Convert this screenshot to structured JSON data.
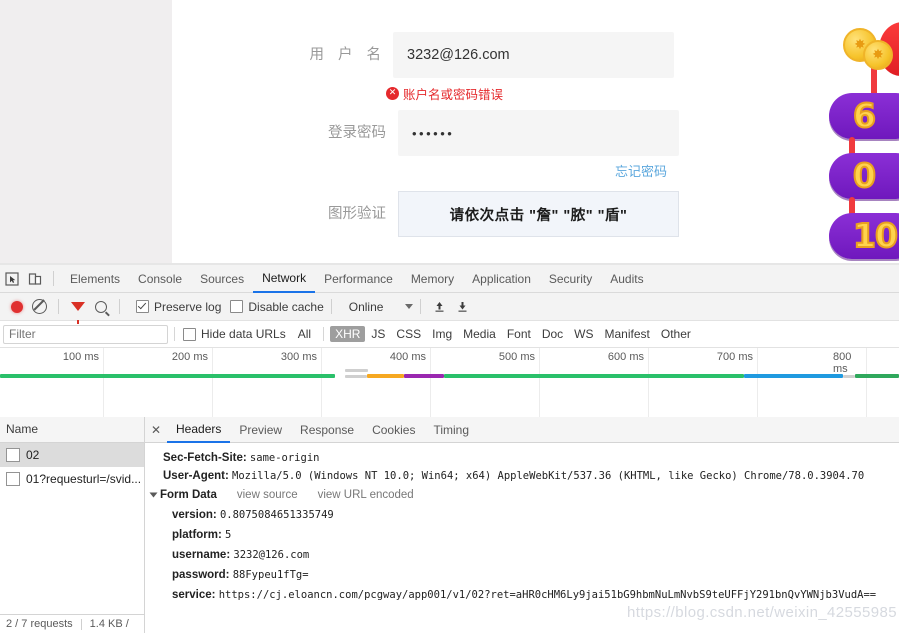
{
  "login": {
    "username": {
      "label": "用 户 名",
      "value": "3232@126.com",
      "error": "账户名或密码错误",
      "error_icon": "error-circle-icon"
    },
    "password": {
      "label": "登录密码",
      "value": "••••••",
      "forgot_label": "忘记密码"
    },
    "captcha": {
      "label": "图形验证",
      "prompt": "请依次点击 \"詹\" \"脓\" \"盾\""
    },
    "decoration": {
      "pill_numbers": [
        "6",
        "0",
        "10."
      ],
      "coin_icon": "coin-icon",
      "red_blob_icon": "red-blob-icon"
    }
  },
  "devtools": {
    "icons": {
      "inspect": "inspect-element-icon",
      "device": "device-toolbar-icon"
    },
    "panels": [
      {
        "label": "Elements",
        "active": false
      },
      {
        "label": "Console",
        "active": false
      },
      {
        "label": "Sources",
        "active": false
      },
      {
        "label": "Network",
        "active": true
      },
      {
        "label": "Performance",
        "active": false
      },
      {
        "label": "Memory",
        "active": false
      },
      {
        "label": "Application",
        "active": false
      },
      {
        "label": "Security",
        "active": false
      },
      {
        "label": "Audits",
        "active": false
      }
    ],
    "toolbar": {
      "record_icon": "record-icon",
      "clear_icon": "clear-icon",
      "filter_icon": "filter-icon",
      "search_icon": "search-icon",
      "preserve_log": {
        "label": "Preserve log",
        "checked": true
      },
      "disable_cache": {
        "label": "Disable cache",
        "checked": false
      },
      "throttling": {
        "value": "Online"
      },
      "import_icon": "import-har-icon",
      "export_icon": "export-har-icon"
    },
    "filterbar": {
      "filter_placeholder": "Filter",
      "filter_value": "",
      "hide_data_urls": {
        "label": "Hide data URLs",
        "checked": false
      },
      "types": [
        {
          "label": "All",
          "active": false
        },
        {
          "label": "XHR",
          "active": true
        },
        {
          "label": "JS",
          "active": false
        },
        {
          "label": "CSS",
          "active": false
        },
        {
          "label": "Img",
          "active": false
        },
        {
          "label": "Media",
          "active": false
        },
        {
          "label": "Font",
          "active": false
        },
        {
          "label": "Doc",
          "active": false
        },
        {
          "label": "WS",
          "active": false
        },
        {
          "label": "Manifest",
          "active": false
        },
        {
          "label": "Other",
          "active": false
        }
      ]
    },
    "overview": {
      "ticks": [
        "100 ms",
        "200 ms",
        "300 ms",
        "400 ms",
        "500 ms",
        "600 ms",
        "700 ms",
        "800 ms"
      ]
    },
    "requests": {
      "column_header": "Name",
      "rows": [
        {
          "name": "02",
          "selected": true
        },
        {
          "name": "01?requesturl=/svid...",
          "selected": false
        }
      ],
      "status": {
        "requests": "2 / 7 requests",
        "transferred": "1.4 KB /"
      }
    },
    "detail": {
      "close_icon": "close-icon",
      "tabs": [
        {
          "label": "Headers",
          "active": true
        },
        {
          "label": "Preview",
          "active": false
        },
        {
          "label": "Response",
          "active": false
        },
        {
          "label": "Cookies",
          "active": false
        },
        {
          "label": "Timing",
          "active": false
        }
      ],
      "headers": [
        {
          "name": "Sec-Fetch-Site:",
          "value": "same-origin"
        },
        {
          "name": "User-Agent:",
          "value": "Mozilla/5.0 (Windows NT 10.0; Win64; x64) AppleWebKit/537.36 (KHTML, like Gecko) Chrome/78.0.3904.70"
        }
      ],
      "form_data": {
        "title": "Form Data",
        "view_source": "view source",
        "view_url_encoded": "view URL encoded",
        "entries": [
          {
            "key": "version:",
            "value": "0.8075084651335749"
          },
          {
            "key": "platform:",
            "value": "5"
          },
          {
            "key": "username:",
            "value": "3232@126.com"
          },
          {
            "key": "password:",
            "value": "88Fypeu1fTg="
          },
          {
            "key": "service:",
            "value": "https://cj.eloancn.com/pcgway/app001/v1/02?ret=aHR0cHM6Ly9jai51bG9hbmNuLmNvbS9teUFFjY291bnQvYWNjb3VudA=="
          }
        ]
      }
    }
  },
  "watermark": "https://blog.csdn.net/weixin_42555985"
}
